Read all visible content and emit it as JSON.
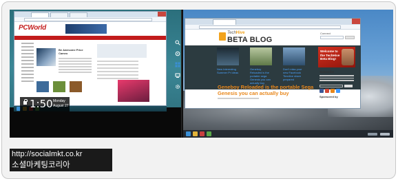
{
  "left_pane": {
    "browser": {
      "site_logo": "PCWorld",
      "feature_headline": "Be Awesome Price Cameo"
    },
    "lock_screen_clock": {
      "time": "1:50",
      "day": "Monday",
      "date": "August 27"
    }
  },
  "charms": {
    "icons": [
      "search-icon",
      "share-icon",
      "start-icon",
      "devices-icon",
      "settings-icon"
    ]
  },
  "right_pane": {
    "browser": {
      "brand_prefix": "Tech",
      "brand_suffix": "Hive",
      "blog_title": "BETA BLOG",
      "header_links": "Connect",
      "thumb_captions": [
        "New Interesting Summer Pr Ideas",
        "Geneboy Reloaded is the portable sega Genesis you can actually buy",
        "Don't miss your new Facebook Timeline share prepared"
      ],
      "article_headline": "Geneboy Reloaded is the portable Sega Genesis you can actually buy",
      "promo_text": "Welcome to the TechHive Beta Blog!",
      "subscribe_heading": "Subscribe",
      "sponsor_heading": "Sponsored by"
    }
  },
  "watermark": {
    "url": "http://socialmkt.co.kr",
    "name": "소셜마케팅코리아"
  },
  "colors": {
    "pcworld_red": "#c21b1b",
    "techhive_orange": "#e8871b",
    "taskbar_dark": "#153c49"
  }
}
